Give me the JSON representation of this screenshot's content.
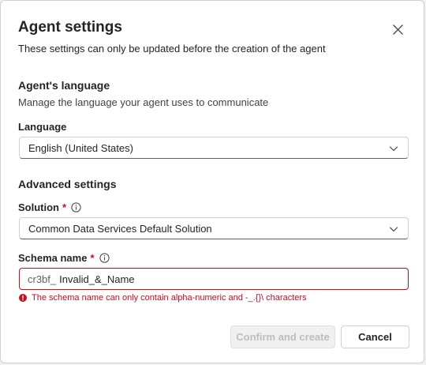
{
  "dialog": {
    "title": "Agent settings",
    "subtitle": "These settings can only be updated before the creation of the agent"
  },
  "language_section": {
    "title": "Agent's language",
    "description": "Manage the language your agent uses to communicate",
    "field_label": "Language",
    "selected_value": "English (United States)"
  },
  "advanced_section": {
    "title": "Advanced settings",
    "solution": {
      "label": "Solution",
      "required_marker": "*",
      "selected_value": "Common Data Services Default Solution"
    },
    "schema_name": {
      "label": "Schema name",
      "required_marker": "*",
      "prefix": "cr3bf_",
      "value": "Invalid_&_Name",
      "error": "The schema name can only contain alpha-numeric and -_.{}\\ characters"
    }
  },
  "footer": {
    "confirm_label": "Confirm and create",
    "cancel_label": "Cancel"
  },
  "colors": {
    "error": "#c50f1f",
    "border": "#d1d1d1",
    "text": "#242424"
  },
  "icons": {
    "close": "close-icon",
    "info": "info-icon",
    "chevron": "chevron-down-icon",
    "error": "error-circle-icon"
  }
}
